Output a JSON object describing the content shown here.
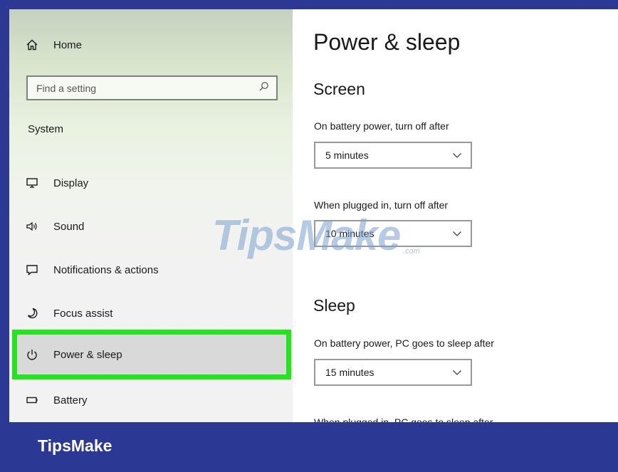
{
  "sidebar": {
    "home_label": "Home",
    "search_placeholder": "Find a setting",
    "section_label": "System",
    "items": [
      {
        "label": "Display",
        "icon": "display-icon"
      },
      {
        "label": "Sound",
        "icon": "sound-icon"
      },
      {
        "label": "Notifications & actions",
        "icon": "notifications-icon"
      },
      {
        "label": "Focus assist",
        "icon": "focus-assist-icon"
      },
      {
        "label": "Power & sleep",
        "icon": "power-icon"
      },
      {
        "label": "Battery",
        "icon": "battery-icon"
      }
    ],
    "active_item": "Power & sleep",
    "highlight_color": "#22e61c"
  },
  "main": {
    "title": "Power & sleep",
    "screen": {
      "heading": "Screen",
      "battery_label": "On battery power, turn off after",
      "battery_value": "5 minutes",
      "plugged_label": "When plugged in, turn off after",
      "plugged_value": "10 minutes"
    },
    "sleep": {
      "heading": "Sleep",
      "battery_label": "On battery power, PC goes to sleep after",
      "battery_value": "15 minutes",
      "plugged_label": "When plugged in, PC goes to sleep after"
    }
  },
  "watermark": {
    "text": "TipsMake",
    "suffix": ".com"
  },
  "footer": {
    "brand": "TipsMake",
    "background": "#2b3894"
  }
}
